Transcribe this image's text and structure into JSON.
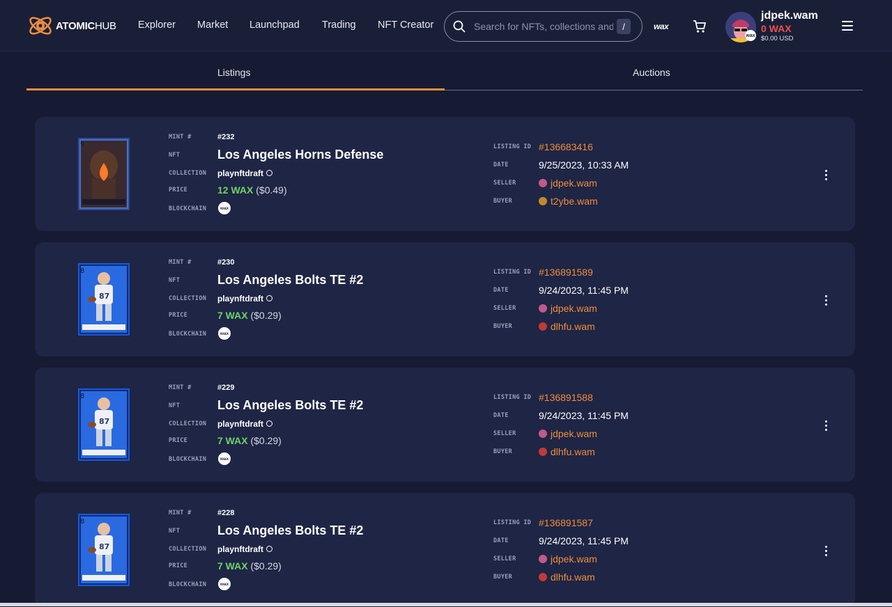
{
  "header": {
    "logo_bold": "ATOMIC",
    "logo_light": "HUB",
    "nav": [
      "Explorer",
      "Market",
      "Launchpad",
      "Trading",
      "NFT Creator"
    ],
    "search_placeholder": "Search for NFTs, collections and",
    "search_shortcut": "/",
    "wax_label": "wax",
    "user": {
      "name": "jdpek.wam",
      "balance": "0 WAX",
      "usd": "$0.00 USD",
      "badge": "wax"
    }
  },
  "tabs": {
    "listings": "Listings",
    "auctions": "Auctions",
    "active": "Listings"
  },
  "labels": {
    "mint": "MINT #",
    "nft": "NFT",
    "collection": "COLLECTION",
    "price": "PRICE",
    "blockchain": "BLOCKCHAIN",
    "listing_id": "LISTING ID",
    "date": "DATE",
    "seller": "SELLER",
    "buyer": "BUYER"
  },
  "chain_badge": "wax",
  "colors": {
    "accent": "#ee8e3c",
    "wax_price": "#6cd36a",
    "balance": "#f0504a",
    "card": "#1f2544",
    "bg": "#161b33"
  },
  "listings": [
    {
      "mint": "#232",
      "name": "Los Angeles Horns Defense",
      "collection": "playnftdraft",
      "price_wax": "12 WAX",
      "price_usd": "($0.49)",
      "listing_id": "#136683416",
      "date": "9/25/2023, 10:33 AM",
      "seller": "jdpek.wam",
      "buyer": "t2ybe.wam",
      "card_icon": "flame-helmet-card"
    },
    {
      "mint": "#230",
      "name": "Los Angeles Bolts TE #2",
      "collection": "playnftdraft",
      "price_wax": "7 WAX",
      "price_usd": "($0.29)",
      "listing_id": "#136891589",
      "date": "9/24/2023, 11:45 PM",
      "seller": "jdpek.wam",
      "buyer": "dlhfu.wam",
      "card_icon": "football-player-card"
    },
    {
      "mint": "#229",
      "name": "Los Angeles Bolts TE #2",
      "collection": "playnftdraft",
      "price_wax": "7 WAX",
      "price_usd": "($0.29)",
      "listing_id": "#136891588",
      "date": "9/24/2023, 11:45 PM",
      "seller": "jdpek.wam",
      "buyer": "dlhfu.wam",
      "card_icon": "football-player-card"
    },
    {
      "mint": "#228",
      "name": "Los Angeles Bolts TE #2",
      "collection": "playnftdraft",
      "price_wax": "7 WAX",
      "price_usd": "($0.29)",
      "listing_id": "#136891587",
      "date": "9/24/2023, 11:45 PM",
      "seller": "jdpek.wam",
      "buyer": "dlhfu.wam",
      "card_icon": "football-player-card"
    }
  ]
}
